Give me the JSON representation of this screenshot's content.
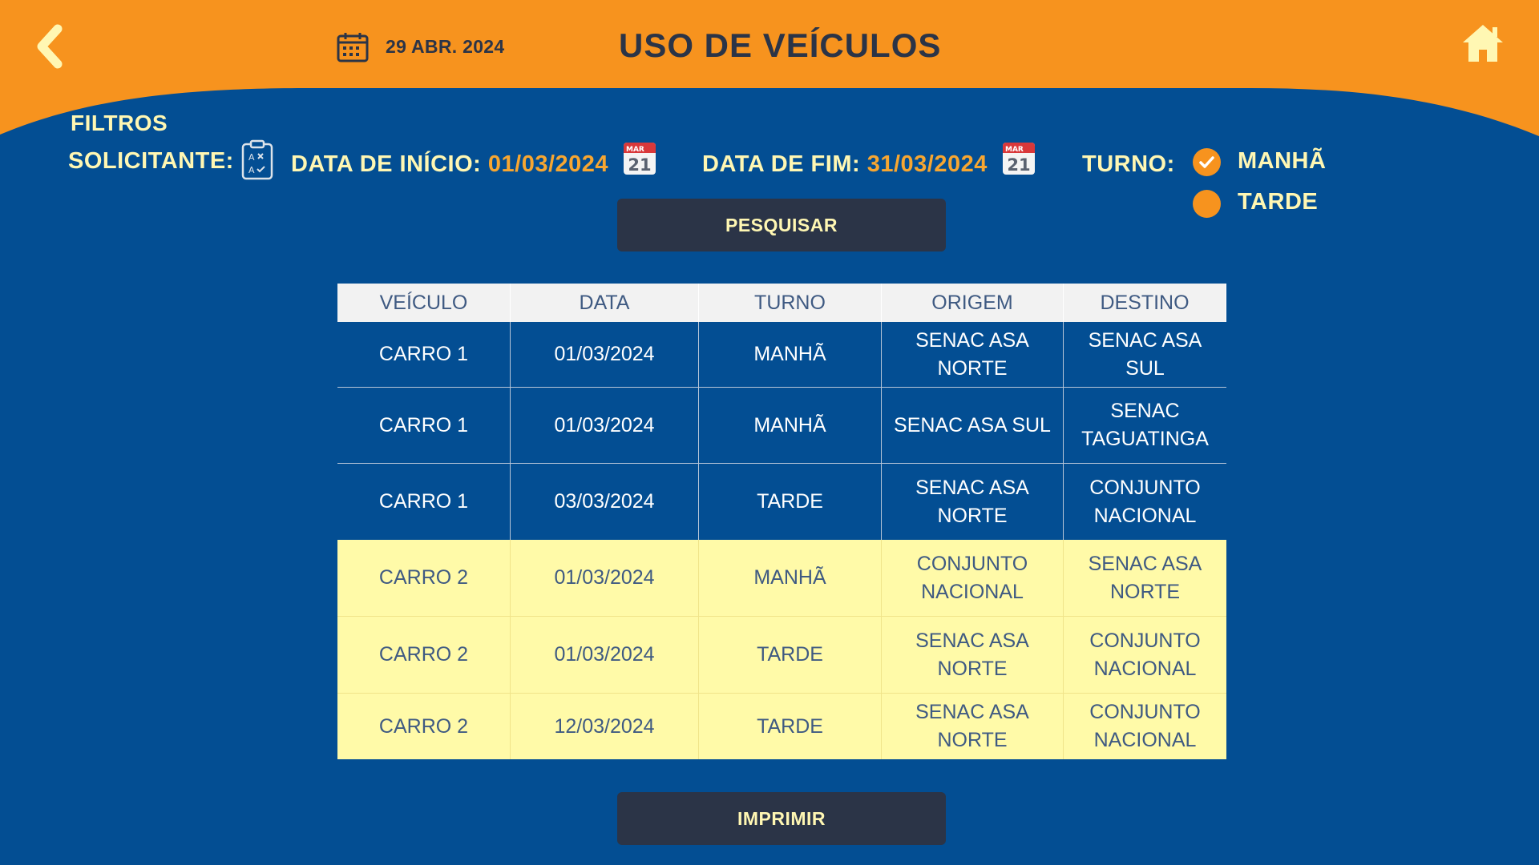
{
  "header": {
    "title": "USO DE VEÍCULOS",
    "date": "29 ABR. 2024",
    "back_icon": "chevron-left-icon",
    "home_icon": "home-icon",
    "calendar_icon": "calendar-icon"
  },
  "filters": {
    "title": "FILTROS",
    "solicitante_label": "SOLICITANTE:",
    "start_label": "DATA DE INÍCIO:",
    "start_value": "01/03/2024",
    "end_label": "DATA DE FIM:",
    "end_value": "31/03/2024",
    "calendar_month": "MAR",
    "calendar_day": "21",
    "turno_label": "TURNO:",
    "turno_options": [
      {
        "label": "MANHÃ",
        "checked": true
      },
      {
        "label": "TARDE",
        "checked": false
      }
    ]
  },
  "buttons": {
    "search": "PESQUISAR",
    "print": "IMPRIMIR"
  },
  "table": {
    "headers": [
      "VEÍCULO",
      "DATA",
      "TURNO",
      "ORIGEM",
      "DESTINO"
    ],
    "rows": [
      [
        "CARRO 1",
        "01/03/2024",
        "MANHÃ",
        "SENAC ASA NORTE",
        "SENAC ASA SUL"
      ],
      [
        "CARRO 1",
        "01/03/2024",
        "MANHÃ",
        "SENAC ASA SUL",
        "SENAC TAGUATINGA"
      ],
      [
        "CARRO 1",
        "03/03/2024",
        "TARDE",
        "SENAC ASA NORTE",
        "CONJUNTO NACIONAL"
      ],
      [
        "CARRO 2",
        "01/03/2024",
        "MANHÃ",
        "CONJUNTO NACIONAL",
        "SENAC ASA NORTE"
      ],
      [
        "CARRO 2",
        "01/03/2024",
        "TARDE",
        "SENAC ASA NORTE",
        "CONJUNTO NACIONAL"
      ],
      [
        "CARRO 2",
        "12/03/2024",
        "TARDE",
        "SENAC ASA NORTE",
        "CONJUNTO NACIONAL"
      ]
    ]
  },
  "colors": {
    "header_orange": "#F7931E",
    "background_blue": "#034E93",
    "dark_navy": "#2B3447",
    "cream_text": "#FFF7B3",
    "value_orange": "#F7A631",
    "row_yellow": "#FFFAA8"
  }
}
